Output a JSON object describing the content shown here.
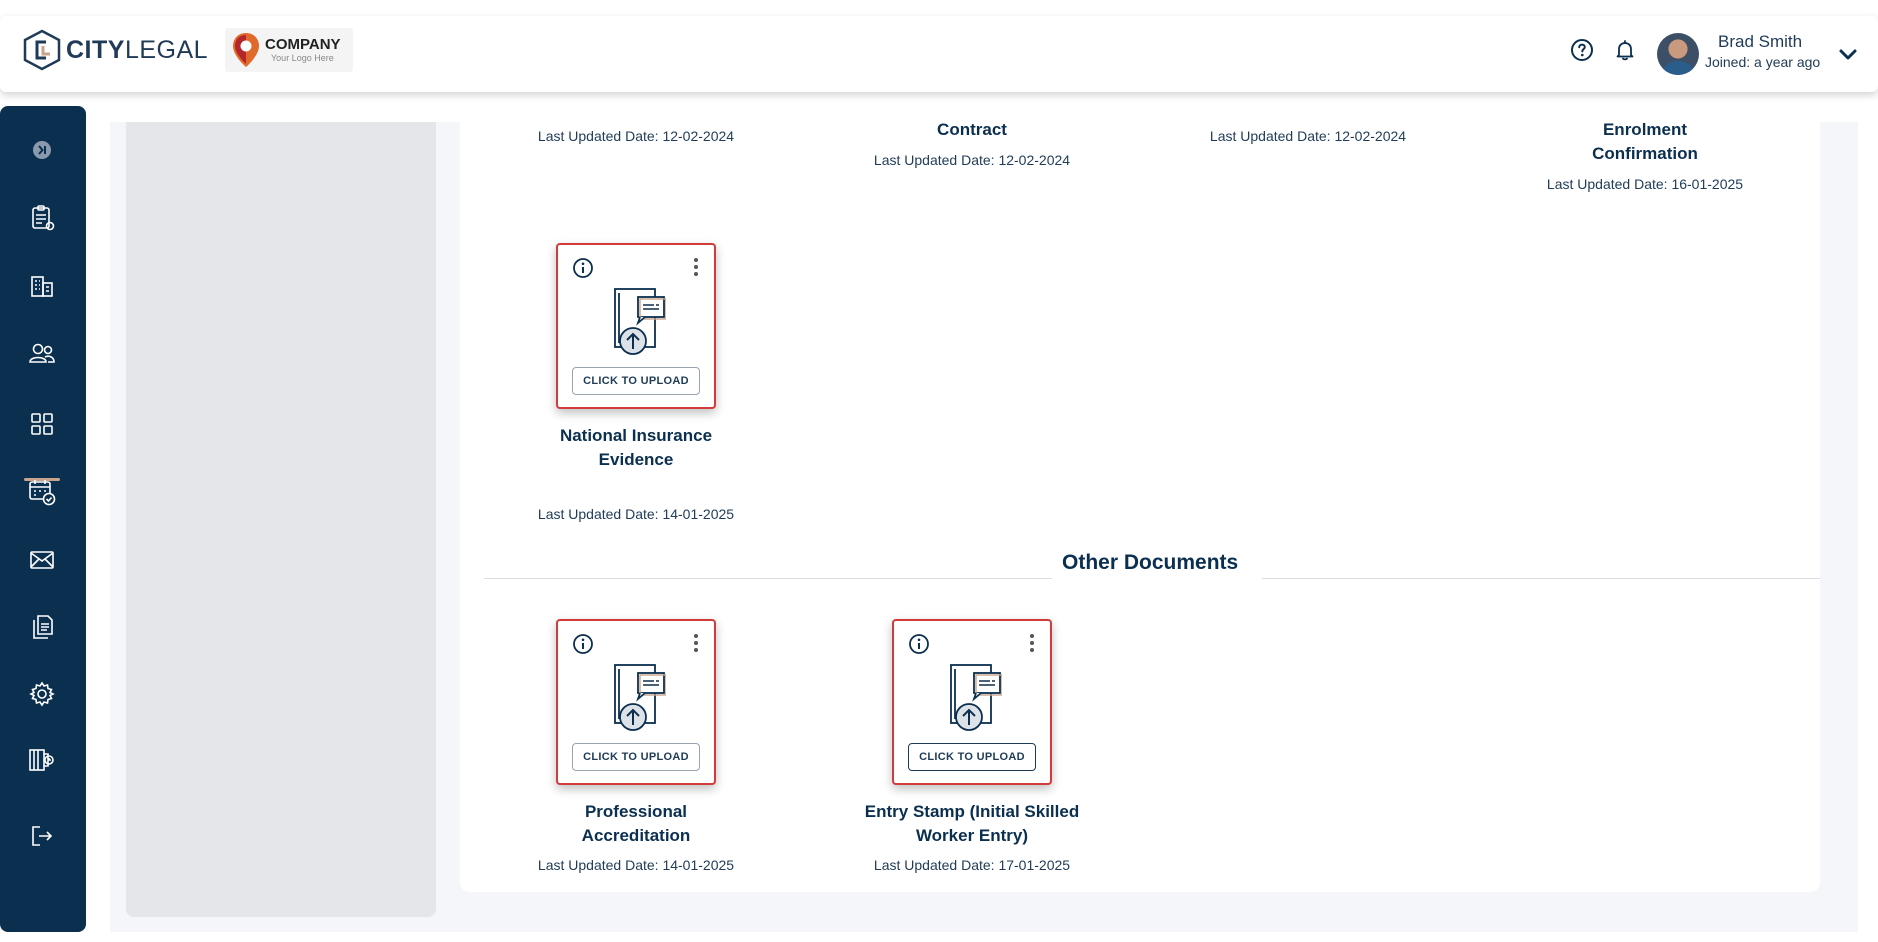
{
  "brand": {
    "city": "CITY",
    "legal": "LEGAL"
  },
  "company": {
    "name": "COMPANY",
    "tagline": "Your Logo Here"
  },
  "user": {
    "name": "Brad Smith",
    "joined": "Joined: a year ago"
  },
  "top_docs": [
    {
      "title": "",
      "updated": "Last Updated Date: 12-02-2024"
    },
    {
      "title": "Contract",
      "updated": "Last Updated Date: 12-02-2024"
    },
    {
      "title": "",
      "updated": "Last Updated Date: 12-02-2024"
    },
    {
      "title": "Enrolment Confirmation",
      "updated": "Last Updated Date: 16-01-2025"
    }
  ],
  "cards": [
    {
      "title": "National Insurance Evidence",
      "updated": "Last Updated Date: 14-01-2025",
      "button": "CLICK TO UPLOAD"
    },
    {
      "title": "Professional Accreditation",
      "updated": "Last Updated Date: 14-01-2025",
      "button": "CLICK TO UPLOAD"
    },
    {
      "title": "Entry Stamp (Initial Skilled Worker Entry)",
      "updated": "Last Updated Date: 17-01-2025",
      "button": "CLICK TO UPLOAD"
    }
  ],
  "sections": {
    "other_documents": "Other Documents"
  },
  "colors": {
    "navy": "#0b2f4f",
    "accent": "#d33a3a",
    "active_underline": "#c8a48c"
  }
}
